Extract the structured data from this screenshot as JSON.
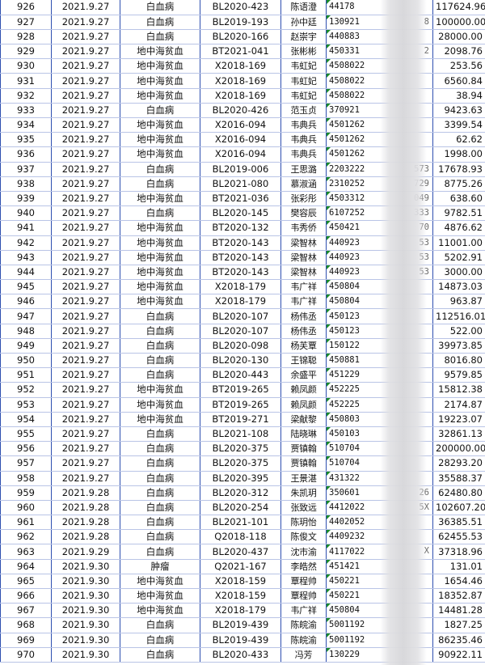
{
  "rows": [
    {
      "no": "926",
      "date": "2021.9.27",
      "diagnosis": "白血病",
      "case_code": "BL2020-423",
      "name": "陈语澄",
      "id_visible": "44178",
      "id_tail": "",
      "amount": "117624.96"
    },
    {
      "no": "927",
      "date": "2021.9.27",
      "diagnosis": "白血病",
      "case_code": "BL2019-193",
      "name": "孙中廷",
      "id_visible": "130921",
      "id_tail": "8",
      "amount": "100000.00"
    },
    {
      "no": "928",
      "date": "2021.9.27",
      "diagnosis": "白血病",
      "case_code": "BL2020-166",
      "name": "赵崇宇",
      "id_visible": "440883",
      "id_tail": "",
      "amount": "28000.00"
    },
    {
      "no": "929",
      "date": "2021.9.27",
      "diagnosis": "地中海贫血",
      "case_code": "BT2021-041",
      "name": "张彬彬",
      "id_visible": "450331",
      "id_tail": "2",
      "amount": "2098.76"
    },
    {
      "no": "930",
      "date": "2021.9.27",
      "diagnosis": "地中海贫血",
      "case_code": "X2018-169",
      "name": "韦虹妃",
      "id_visible": "4508022",
      "id_tail": "",
      "amount": "253.56"
    },
    {
      "no": "931",
      "date": "2021.9.27",
      "diagnosis": "地中海贫血",
      "case_code": "X2018-169",
      "name": "韦虹妃",
      "id_visible": "4508022",
      "id_tail": "",
      "amount": "6560.84"
    },
    {
      "no": "932",
      "date": "2021.9.27",
      "diagnosis": "地中海贫血",
      "case_code": "X2018-169",
      "name": "韦虹妃",
      "id_visible": "4508022",
      "id_tail": "",
      "amount": "38.94"
    },
    {
      "no": "933",
      "date": "2021.9.27",
      "diagnosis": "白血病",
      "case_code": "BL2020-426",
      "name": "范玉贞",
      "id_visible": "370921",
      "id_tail": "",
      "amount": "9423.63"
    },
    {
      "no": "934",
      "date": "2021.9.27",
      "diagnosis": "地中海贫血",
      "case_code": "X2016-094",
      "name": "韦典兵",
      "id_visible": "4501262",
      "id_tail": "",
      "amount": "3399.54"
    },
    {
      "no": "935",
      "date": "2021.9.27",
      "diagnosis": "地中海贫血",
      "case_code": "X2016-094",
      "name": "韦典兵",
      "id_visible": "4501262",
      "id_tail": "",
      "amount": "62.62"
    },
    {
      "no": "936",
      "date": "2021.9.27",
      "diagnosis": "地中海贫血",
      "case_code": "X2016-094",
      "name": "韦典兵",
      "id_visible": "4501262",
      "id_tail": "",
      "amount": "1998.00"
    },
    {
      "no": "937",
      "date": "2021.9.27",
      "diagnosis": "白血病",
      "case_code": "BL2019-006",
      "name": "王思潞",
      "id_visible": "2203222",
      "id_tail": "573",
      "amount": "17678.93"
    },
    {
      "no": "938",
      "date": "2021.9.27",
      "diagnosis": "白血病",
      "case_code": "BL2021-080",
      "name": "慕淑涵",
      "id_visible": "2310252",
      "id_tail": "729",
      "amount": "8775.26"
    },
    {
      "no": "939",
      "date": "2021.9.27",
      "diagnosis": "地中海贫血",
      "case_code": "BT2021-036",
      "name": "张彩彤",
      "id_visible": "4503312",
      "id_tail": "049",
      "amount": "638.60"
    },
    {
      "no": "940",
      "date": "2021.9.27",
      "diagnosis": "白血病",
      "case_code": "BL2020-145",
      "name": "樊容辰",
      "id_visible": "6107252",
      "id_tail": "333",
      "amount": "9782.51"
    },
    {
      "no": "941",
      "date": "2021.9.27",
      "diagnosis": "地中海贫血",
      "case_code": "BT2020-132",
      "name": "韦秀侨",
      "id_visible": "450421",
      "id_tail": "70",
      "amount": "4876.62"
    },
    {
      "no": "942",
      "date": "2021.9.27",
      "diagnosis": "地中海贫血",
      "case_code": "BT2020-143",
      "name": "梁智林",
      "id_visible": "440923",
      "id_tail": "53",
      "amount": "11001.00"
    },
    {
      "no": "943",
      "date": "2021.9.27",
      "diagnosis": "地中海贫血",
      "case_code": "BT2020-143",
      "name": "梁智林",
      "id_visible": "440923",
      "id_tail": "53",
      "amount": "5202.91"
    },
    {
      "no": "944",
      "date": "2021.9.27",
      "diagnosis": "地中海贫血",
      "case_code": "BT2020-143",
      "name": "梁智林",
      "id_visible": "440923",
      "id_tail": "53",
      "amount": "3000.00"
    },
    {
      "no": "945",
      "date": "2021.9.27",
      "diagnosis": "地中海贫血",
      "case_code": "X2018-179",
      "name": "韦广祥",
      "id_visible": "450804",
      "id_tail": "",
      "amount": "14873.03"
    },
    {
      "no": "946",
      "date": "2021.9.27",
      "diagnosis": "地中海贫血",
      "case_code": "X2018-179",
      "name": "韦广祥",
      "id_visible": "450804",
      "id_tail": "",
      "amount": "963.87"
    },
    {
      "no": "947",
      "date": "2021.9.27",
      "diagnosis": "白血病",
      "case_code": "BL2020-107",
      "name": "杨伟丞",
      "id_visible": "450123",
      "id_tail": "",
      "amount": "112516.01"
    },
    {
      "no": "948",
      "date": "2021.9.27",
      "diagnosis": "白血病",
      "case_code": "BL2020-107",
      "name": "杨伟丞",
      "id_visible": "450123",
      "id_tail": "",
      "amount": "522.00"
    },
    {
      "no": "949",
      "date": "2021.9.27",
      "diagnosis": "白血病",
      "case_code": "BL2020-098",
      "name": "杨芙覃",
      "id_visible": "150122",
      "id_tail": "",
      "amount": "39973.85"
    },
    {
      "no": "950",
      "date": "2021.9.27",
      "diagnosis": "白血病",
      "case_code": "BL2020-130",
      "name": "王锦聪",
      "id_visible": "450881",
      "id_tail": "",
      "amount": "8016.80"
    },
    {
      "no": "951",
      "date": "2021.9.27",
      "diagnosis": "白血病",
      "case_code": "BL2020-443",
      "name": "余盛平",
      "id_visible": "451229",
      "id_tail": "",
      "amount": "9579.85"
    },
    {
      "no": "952",
      "date": "2021.9.27",
      "diagnosis": "地中海贫血",
      "case_code": "BT2019-265",
      "name": "赖凤颜",
      "id_visible": "452225",
      "id_tail": "",
      "amount": "15812.38"
    },
    {
      "no": "953",
      "date": "2021.9.27",
      "diagnosis": "地中海贫血",
      "case_code": "BT2019-265",
      "name": "赖凤颜",
      "id_visible": "452225",
      "id_tail": "",
      "amount": "2174.87"
    },
    {
      "no": "954",
      "date": "2021.9.27",
      "diagnosis": "地中海贫血",
      "case_code": "BT2019-271",
      "name": "梁献黎",
      "id_visible": "450803",
      "id_tail": "",
      "amount": "19223.07"
    },
    {
      "no": "955",
      "date": "2021.9.27",
      "diagnosis": "白血病",
      "case_code": "BL2021-108",
      "name": "陆晓琳",
      "id_visible": "450103",
      "id_tail": "",
      "amount": "32861.13"
    },
    {
      "no": "956",
      "date": "2021.9.27",
      "diagnosis": "白血病",
      "case_code": "BL2020-375",
      "name": "贾镇翰",
      "id_visible": "510704",
      "id_tail": "",
      "amount": "200000.00"
    },
    {
      "no": "957",
      "date": "2021.9.27",
      "diagnosis": "白血病",
      "case_code": "BL2020-375",
      "name": "贾镇翰",
      "id_visible": "510704",
      "id_tail": "",
      "amount": "28293.20"
    },
    {
      "no": "958",
      "date": "2021.9.27",
      "diagnosis": "白血病",
      "case_code": "BL2020-395",
      "name": "王景湛",
      "id_visible": "431322",
      "id_tail": "",
      "amount": "35588.37"
    },
    {
      "no": "959",
      "date": "2021.9.28",
      "diagnosis": "白血病",
      "case_code": "BL2020-312",
      "name": "朱凯玥",
      "id_visible": "350601",
      "id_tail": "26",
      "amount": "62480.80"
    },
    {
      "no": "960",
      "date": "2021.9.28",
      "diagnosis": "白血病",
      "case_code": "BL2020-254",
      "name": "张致远",
      "id_visible": "4412022",
      "id_tail": "5X",
      "amount": "102607.20"
    },
    {
      "no": "961",
      "date": "2021.9.28",
      "diagnosis": "白血病",
      "case_code": "BL2021-101",
      "name": "陈玥怡",
      "id_visible": "4402052",
      "id_tail": "",
      "amount": "36385.51"
    },
    {
      "no": "962",
      "date": "2021.9.28",
      "diagnosis": "白血病",
      "case_code": "Q2018-118",
      "name": "陈俊文",
      "id_visible": "4409232",
      "id_tail": "",
      "amount": "62455.53"
    },
    {
      "no": "963",
      "date": "2021.9.29",
      "diagnosis": "白血病",
      "case_code": "BL2020-437",
      "name": "沈市渝",
      "id_visible": "4117022",
      "id_tail": "X",
      "amount": "37318.96"
    },
    {
      "no": "964",
      "date": "2021.9.30",
      "diagnosis": "肿瘤",
      "case_code": "Q2021-167",
      "name": "李皓然",
      "id_visible": "451421",
      "id_tail": "",
      "amount": "131.01"
    },
    {
      "no": "965",
      "date": "2021.9.30",
      "diagnosis": "地中海贫血",
      "case_code": "X2018-159",
      "name": "覃程帅",
      "id_visible": "450221",
      "id_tail": "",
      "amount": "1654.46"
    },
    {
      "no": "966",
      "date": "2021.9.30",
      "diagnosis": "地中海贫血",
      "case_code": "X2018-159",
      "name": "覃程帅",
      "id_visible": "450221",
      "id_tail": "",
      "amount": "18352.87"
    },
    {
      "no": "967",
      "date": "2021.9.30",
      "diagnosis": "地中海贫血",
      "case_code": "X2018-179",
      "name": "韦广祥",
      "id_visible": "450804",
      "id_tail": "",
      "amount": "14481.28"
    },
    {
      "no": "968",
      "date": "2021.9.30",
      "diagnosis": "白血病",
      "case_code": "BL2019-439",
      "name": "陈皖渝",
      "id_visible": "5001192",
      "id_tail": "",
      "amount": "1827.25"
    },
    {
      "no": "969",
      "date": "2021.9.30",
      "diagnosis": "白血病",
      "case_code": "BL2019-439",
      "name": "陈皖渝",
      "id_visible": "5001192",
      "id_tail": "",
      "amount": "86235.46"
    },
    {
      "no": "970",
      "date": "2021.9.30",
      "diagnosis": "白血病",
      "case_code": "BL2020-433",
      "name": "冯芳",
      "id_visible": "130229",
      "id_tail": "",
      "amount": "90922.11"
    }
  ],
  "colors": {
    "grid_line": "#2e4fb0",
    "row_line": "#b9c4e6",
    "note_marker": "#1a8a2a",
    "redaction_blur": "#d7d7da"
  }
}
